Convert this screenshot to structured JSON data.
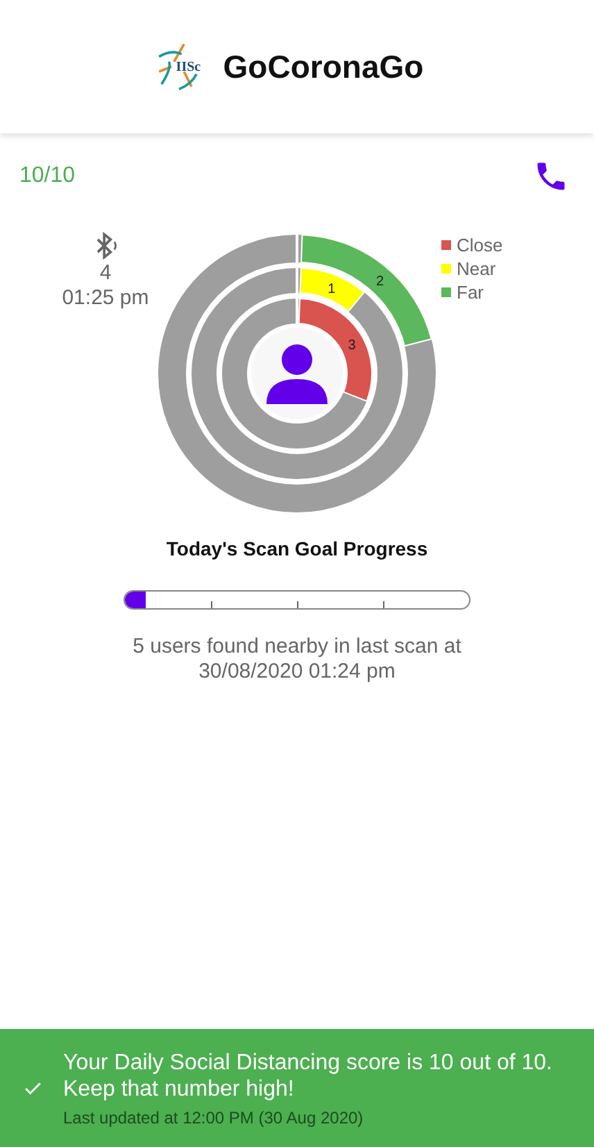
{
  "header": {
    "title": "GoCoronaGo",
    "logo_text": "IISc"
  },
  "score": "10/10",
  "scan": {
    "count": "4",
    "time": "01:25 pm"
  },
  "rings": [
    {
      "value": "2",
      "color": "#5cb85c"
    },
    {
      "value": "1",
      "color": "#ffff00"
    },
    {
      "value": "3",
      "color": "#d9534f"
    }
  ],
  "legend": [
    {
      "label": "Close",
      "color": "#d9534f"
    },
    {
      "label": "Near",
      "color": "#ffff00"
    },
    {
      "label": "Far",
      "color": "#5cb85c"
    }
  ],
  "goal": {
    "title": "Today's Scan Goal Progress",
    "level": 0.06
  },
  "last_scan": "5 users found nearby in last scan at 30/08/2020 01:24 pm",
  "banner": {
    "message": "Your Daily Social Distancing score is 10 out of 10. Keep that number high!",
    "updated": "Last updated at 12:00 PM (30 Aug 2020)"
  }
}
